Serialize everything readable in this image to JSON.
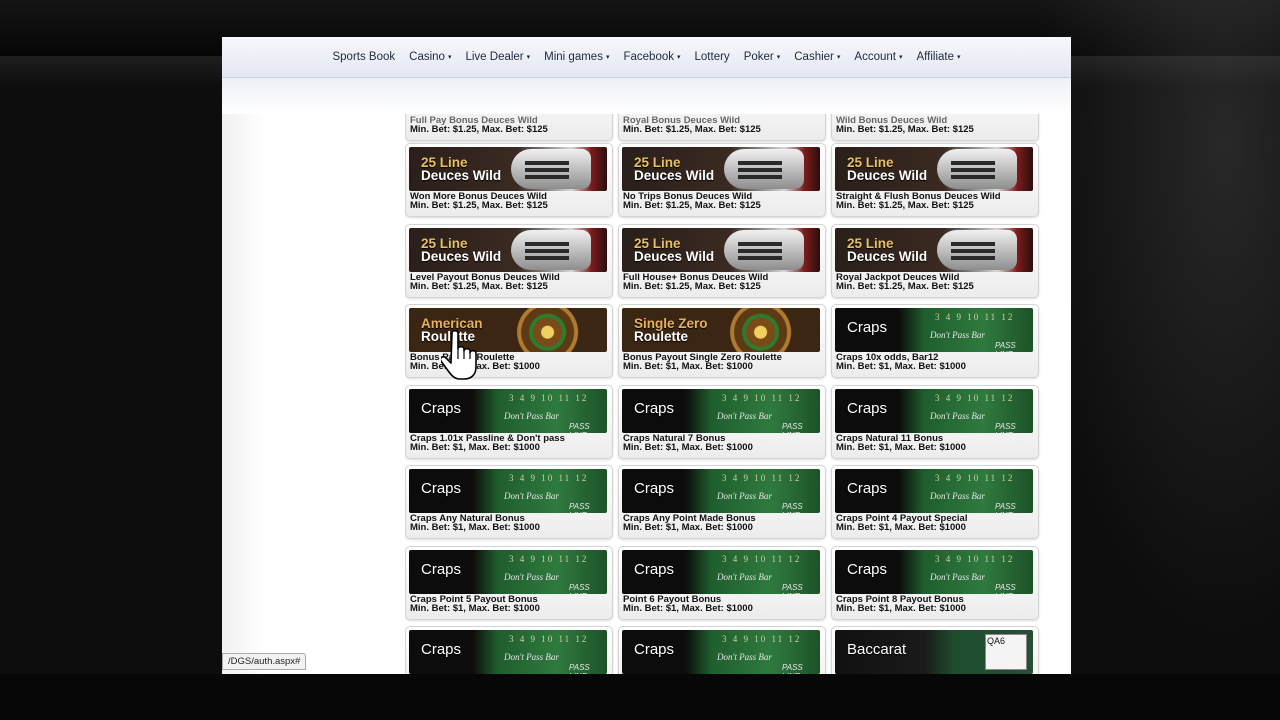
{
  "nav": {
    "items": [
      {
        "label": "Sports Book",
        "dropdown": false
      },
      {
        "label": "Casino",
        "dropdown": true
      },
      {
        "label": "Live Dealer",
        "dropdown": true
      },
      {
        "label": "Mini games",
        "dropdown": true
      },
      {
        "label": "Facebook",
        "dropdown": true
      },
      {
        "label": "Lottery",
        "dropdown": false
      },
      {
        "label": "Poker",
        "dropdown": true
      },
      {
        "label": "Cashier",
        "dropdown": true
      },
      {
        "label": "Account",
        "dropdown": true
      },
      {
        "label": "Affiliate",
        "dropdown": true
      }
    ],
    "caret": "▾"
  },
  "games": {
    "top_row": [
      {
        "name": "Full Pay Bonus Deuces Wild",
        "bet": "Min. Bet: $1.25, Max. Bet: $125"
      },
      {
        "name": "Royal Bonus Deuces Wild",
        "bet": "Min. Bet: $1.25, Max. Bet: $125"
      },
      {
        "name": "Wild Bonus Deuces Wild",
        "bet": "Min. Bet: $1.25, Max. Bet: $125"
      }
    ],
    "rows": [
      [
        {
          "banner": "dw",
          "title": "25 Line",
          "subtitle": "Deuces Wild",
          "name": "Won More Bonus Deuces Wild",
          "bet": "Min. Bet: $1.25, Max. Bet: $125"
        },
        {
          "banner": "dw",
          "title": "25 Line",
          "subtitle": "Deuces Wild",
          "name": "No Trips Bonus Deuces Wild",
          "bet": "Min. Bet: $1.25, Max. Bet: $125"
        },
        {
          "banner": "dw",
          "title": "25 Line",
          "subtitle": "Deuces Wild",
          "name": "Straight & Flush Bonus Deuces Wild",
          "bet": "Min. Bet: $1.25, Max. Bet: $125"
        }
      ],
      [
        {
          "banner": "dw",
          "title": "25 Line",
          "subtitle": "Deuces Wild",
          "name": "Level Payout Bonus Deuces Wild",
          "bet": "Min. Bet: $1.25, Max. Bet: $125"
        },
        {
          "banner": "dw",
          "title": "25 Line",
          "subtitle": "Deuces Wild",
          "name": "Full House+ Bonus Deuces Wild",
          "bet": "Min. Bet: $1.25, Max. Bet: $125"
        },
        {
          "banner": "dw",
          "title": "25 Line",
          "subtitle": "Deuces Wild",
          "name": "Royal Jackpot Deuces Wild",
          "bet": "Min. Bet: $1.25, Max. Bet: $125"
        }
      ],
      [
        {
          "banner": "roulette",
          "title": "American",
          "subtitle": "Roulette",
          "name": "Bonus Payout Roulette",
          "bet": "Min. Bet: $1, Max. Bet: $1000"
        },
        {
          "banner": "roulette",
          "title": "Single Zero",
          "subtitle": "Roulette",
          "name": "Bonus Payout Single Zero Roulette",
          "bet": "Min. Bet: $1, Max. Bet: $1000"
        },
        {
          "banner": "craps",
          "title": "Craps",
          "subtitle": "",
          "name": "Craps 10x odds, Bar12",
          "bet": "Min. Bet: $1, Max. Bet: $1000"
        }
      ],
      [
        {
          "banner": "craps",
          "title": "Craps",
          "subtitle": "",
          "name": "Craps 1.01x Passline & Don't pass",
          "bet": "Min. Bet: $1, Max. Bet: $1000"
        },
        {
          "banner": "craps",
          "title": "Craps",
          "subtitle": "",
          "name": "Craps Natural 7 Bonus",
          "bet": "Min. Bet: $1, Max. Bet: $1000"
        },
        {
          "banner": "craps",
          "title": "Craps",
          "subtitle": "",
          "name": "Craps Natural 11 Bonus",
          "bet": "Min. Bet: $1, Max. Bet: $1000"
        }
      ],
      [
        {
          "banner": "craps",
          "title": "Craps",
          "subtitle": "",
          "name": "Craps Any Natural Bonus",
          "bet": "Min. Bet: $1, Max. Bet: $1000"
        },
        {
          "banner": "craps",
          "title": "Craps",
          "subtitle": "",
          "name": "Craps Any Point Made Bonus",
          "bet": "Min. Bet: $1, Max. Bet: $1000"
        },
        {
          "banner": "craps",
          "title": "Craps",
          "subtitle": "",
          "name": "Craps Point 4 Payout Special",
          "bet": "Min. Bet: $1, Max. Bet: $1000"
        }
      ],
      [
        {
          "banner": "craps",
          "title": "Craps",
          "subtitle": "",
          "name": "Craps Point 5 Payout Bonus",
          "bet": "Min. Bet: $1, Max. Bet: $1000"
        },
        {
          "banner": "craps",
          "title": "Craps",
          "subtitle": "",
          "name": "Point 6 Payout Bonus",
          "bet": "Min. Bet: $1, Max. Bet: $1000"
        },
        {
          "banner": "craps",
          "title": "Craps",
          "subtitle": "",
          "name": "Craps Point 8 Payout Bonus",
          "bet": "Min. Bet: $1, Max. Bet: $1000"
        }
      ],
      [
        {
          "banner": "craps",
          "title": "Craps",
          "subtitle": "",
          "name": "",
          "bet": ""
        },
        {
          "banner": "craps",
          "title": "Craps",
          "subtitle": "",
          "name": "",
          "bet": ""
        },
        {
          "banner": "baccarat",
          "title": "Baccarat",
          "subtitle": "",
          "name": "",
          "bet": ""
        }
      ]
    ],
    "craps_art": {
      "numbers": "3 4 9 10 11 12",
      "dont_pass": "Don't Pass Bar",
      "pass_line": "PASS LINE"
    },
    "baccarat_card": "QA6"
  },
  "status_bar": {
    "url": "/DGS/auth.aspx#"
  }
}
